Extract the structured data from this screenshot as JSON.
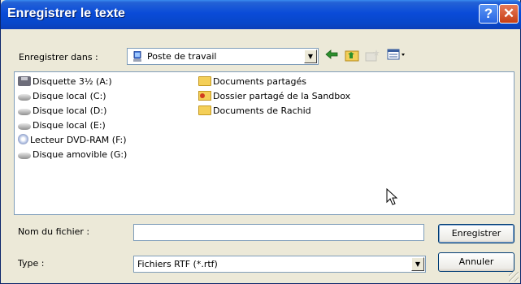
{
  "window": {
    "title": "Enregistrer le texte",
    "help_label": "?",
    "close_label": "✕"
  },
  "savein": {
    "label": "Enregistrer dans :",
    "value": "Poste de travail",
    "icon": "computer-icon"
  },
  "toolbar": {
    "back_icon": "back-arrow-icon",
    "up_icon": "up-folder-icon",
    "newfolder_icon": "new-folder-icon",
    "view_icon": "view-menu-icon"
  },
  "items_left": [
    {
      "label": "Disquette 3½ (A:)",
      "icon": "floppy-icon"
    },
    {
      "label": "Disque local (C:)",
      "icon": "hard-disk-icon"
    },
    {
      "label": "Disque local (D:)",
      "icon": "hard-disk-icon"
    },
    {
      "label": "Disque local (E:)",
      "icon": "hard-disk-icon"
    },
    {
      "label": "Lecteur DVD-RAM (F:)",
      "icon": "dvd-drive-icon"
    },
    {
      "label": "Disque amovible (G:)",
      "icon": "removable-disk-icon"
    }
  ],
  "items_right": [
    {
      "label": "Documents partagés",
      "icon": "folder-icon"
    },
    {
      "label": "Dossier partagé de la Sandbox",
      "icon": "shared-folder-icon"
    },
    {
      "label": "Documents de Rachid",
      "icon": "folder-icon"
    }
  ],
  "filename": {
    "label": "Nom du fichier :",
    "value": ""
  },
  "type": {
    "label": "Type :",
    "value": "Fichiers RTF (*.rtf)"
  },
  "buttons": {
    "save": "Enregistrer",
    "cancel": "Annuler"
  }
}
